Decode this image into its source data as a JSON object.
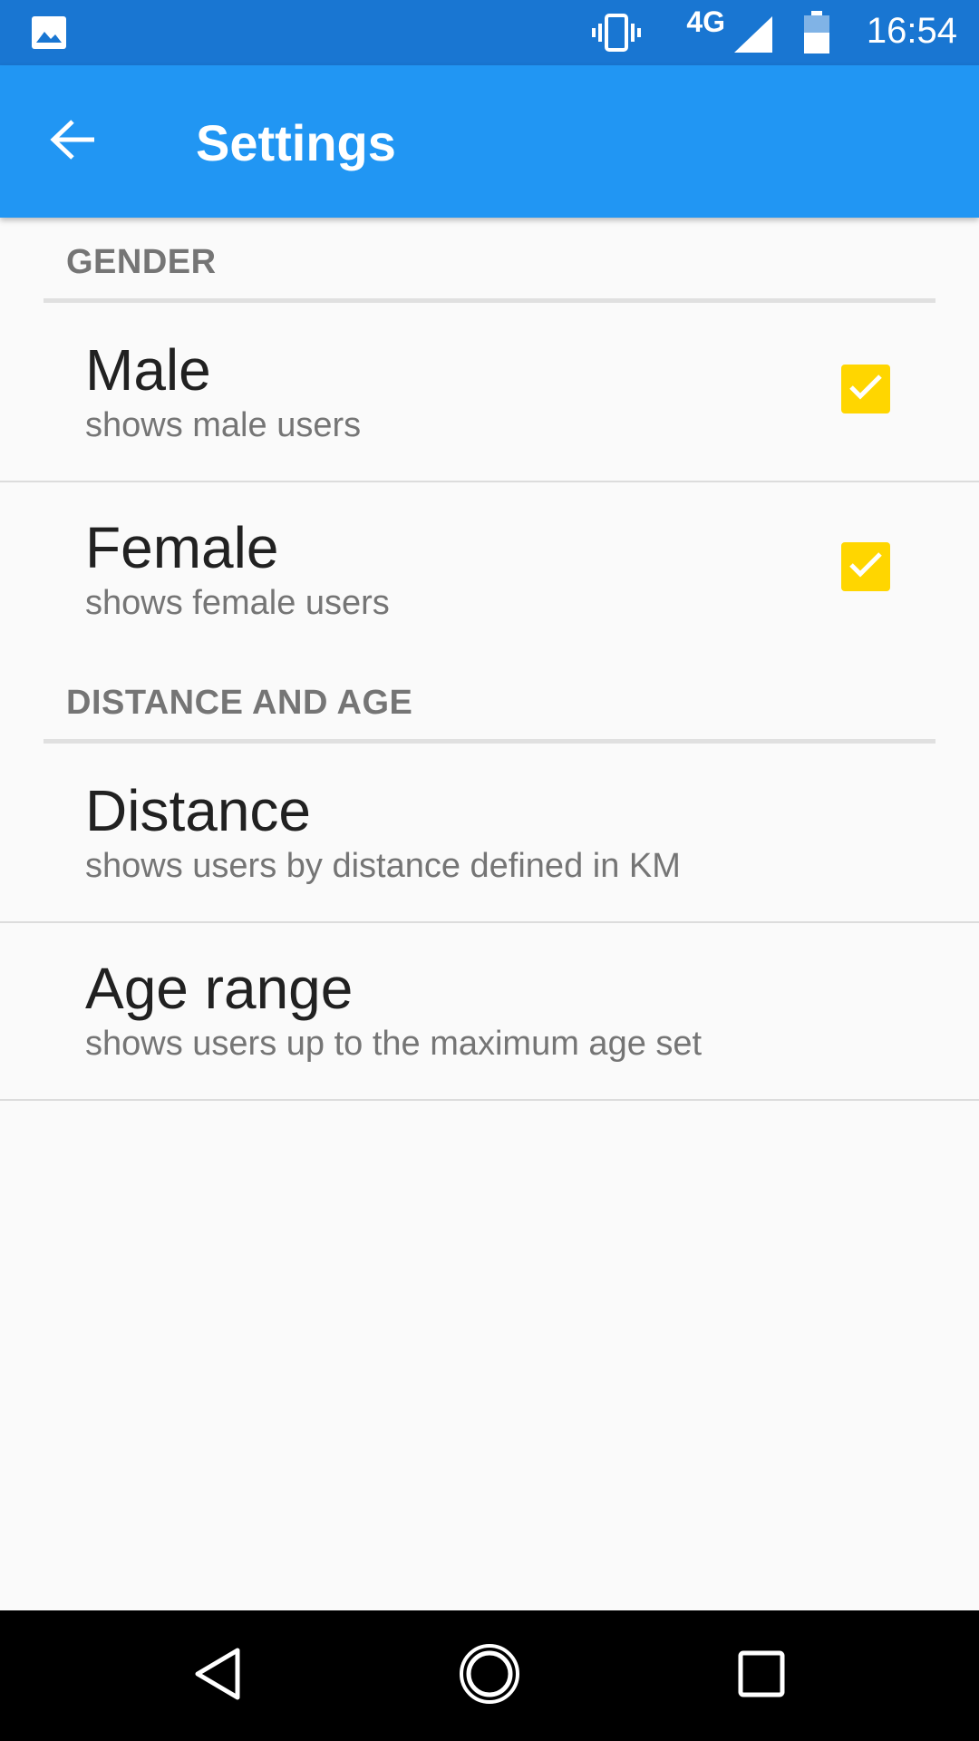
{
  "status_bar": {
    "left_icon": "image-icon",
    "network": "4G",
    "time": "16:54",
    "background": "#1976d2"
  },
  "app_bar": {
    "title": "Settings",
    "back_icon": "arrow-back-icon",
    "background": "#2196f3"
  },
  "sections": [
    {
      "title": "GENDER",
      "items": [
        {
          "title": "Male",
          "summary": "shows male users",
          "checked": true
        },
        {
          "title": "Female",
          "summary": "shows female users",
          "checked": true
        }
      ]
    },
    {
      "title": "DISTANCE AND AGE",
      "items": [
        {
          "title": "Distance",
          "summary": "shows users by distance defined in KM"
        },
        {
          "title": "Age range",
          "summary": "shows users up to the maximum age set"
        }
      ]
    }
  ],
  "colors": {
    "checkbox": "#ffd600",
    "primary_text": "#212121",
    "secondary_text": "#757575"
  },
  "nav_bar": {
    "back_icon": "triangle-back-icon",
    "home_icon": "circle-home-icon",
    "recents_icon": "square-recents-icon"
  }
}
